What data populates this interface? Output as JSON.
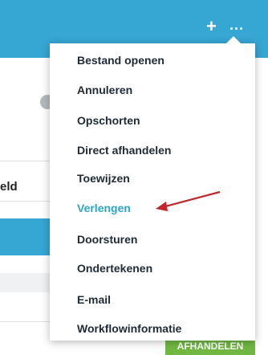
{
  "header": {
    "add_label": "+",
    "more_label": "..."
  },
  "background": {
    "partial_text": "eld",
    "action_button": "AFHANDELEN"
  },
  "menu": {
    "items": [
      {
        "label": "Bestand openen"
      },
      {
        "label": "Annuleren"
      },
      {
        "label": "Opschorten"
      },
      {
        "label": "Direct afhandelen"
      },
      {
        "label": "Toewijzen"
      },
      {
        "label": "Verlengen",
        "active": true
      },
      {
        "label": "Doorsturen"
      },
      {
        "label": "Ondertekenen"
      },
      {
        "label": "E-mail"
      },
      {
        "label": "Workflowinformatie"
      }
    ]
  },
  "colors": {
    "header": "#36a6d3",
    "active_item": "#2aa7c3",
    "annotation_arrow": "#c0262b",
    "action_button": "#71b843"
  }
}
